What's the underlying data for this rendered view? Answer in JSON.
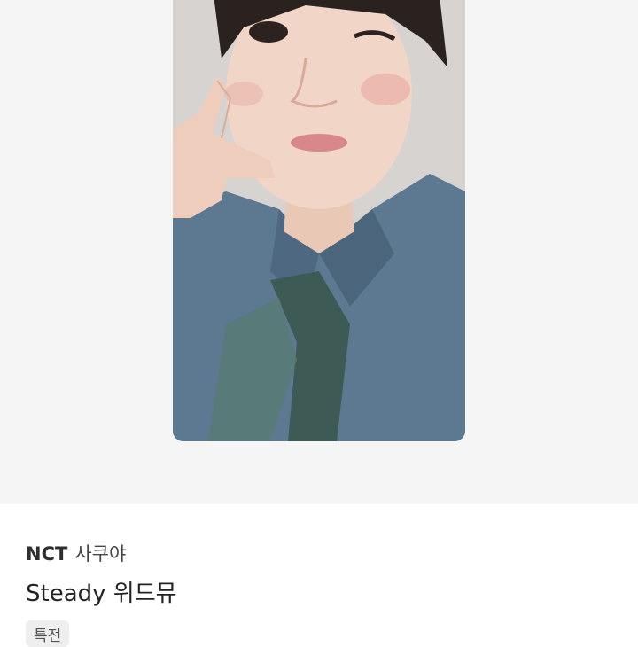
{
  "product": {
    "artist_group": "NCT",
    "member": "사쿠야",
    "title": "Steady 위드뮤",
    "tag": "특전"
  },
  "image": {
    "description_icon": "photocard-image"
  },
  "colors": {
    "page_bg": "#ffffff",
    "photo_bg": "#f5f5f5",
    "tag_bg": "#eeeeee"
  }
}
